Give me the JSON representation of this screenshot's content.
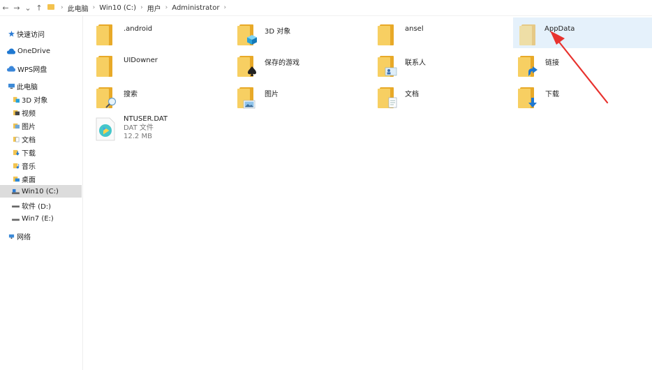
{
  "nav": {
    "back": "←",
    "forward": "→",
    "recent": "⌄",
    "up": "↑",
    "breadcrumb": [
      "此电脑",
      "Win10 (C:)",
      "用户",
      "Administrator"
    ]
  },
  "sidebar": {
    "items": [
      {
        "label": "快速访问",
        "icon": "star-icon"
      },
      {
        "label": "OneDrive",
        "icon": "cloud-icon"
      },
      {
        "label": "WPS网盘",
        "icon": "cloud-icon"
      },
      {
        "label": "此电脑",
        "icon": "computer-icon"
      },
      {
        "label": "3D 对象",
        "icon": "cube-icon"
      },
      {
        "label": "视频",
        "icon": "video-icon"
      },
      {
        "label": "图片",
        "icon": "picture-icon"
      },
      {
        "label": "文档",
        "icon": "document-icon"
      },
      {
        "label": "下载",
        "icon": "download-icon"
      },
      {
        "label": "音乐",
        "icon": "music-icon"
      },
      {
        "label": "桌面",
        "icon": "desktop-icon"
      },
      {
        "label": "Win10 (C:)",
        "icon": "drive-icon",
        "selected": true
      },
      {
        "label": "软件 (D:)",
        "icon": "drive-icon"
      },
      {
        "label": "Win7 (E:)",
        "icon": "drive-icon"
      },
      {
        "label": "网络",
        "icon": "network-icon"
      }
    ]
  },
  "content": {
    "folders": [
      {
        "name": ".android",
        "icon": "folder-icon"
      },
      {
        "name": "3D 对象",
        "icon": "folder-3d-icon"
      },
      {
        "name": "ansel",
        "icon": "folder-icon"
      },
      {
        "name": "AppData",
        "icon": "folder-icon",
        "hovered": true
      },
      {
        "name": "UIDowner",
        "icon": "folder-icon"
      },
      {
        "name": "保存的游戏",
        "icon": "folder-games-icon"
      },
      {
        "name": "联系人",
        "icon": "folder-contacts-icon"
      },
      {
        "name": "链接",
        "icon": "folder-links-icon"
      },
      {
        "name": "搜索",
        "icon": "folder-search-icon"
      },
      {
        "name": "图片",
        "icon": "folder-pictures-icon"
      },
      {
        "name": "文档",
        "icon": "folder-documents-icon"
      },
      {
        "name": "下载",
        "icon": "folder-downloads-icon"
      }
    ],
    "file": {
      "name": "NTUSER.DAT",
      "type": "DAT 文件",
      "size": "12.2 MB",
      "icon": "media-file-icon"
    }
  },
  "annotation": {
    "arrow_color": "#e8322e",
    "target": "AppData"
  },
  "colors": {
    "folder_light": "#f7cf62",
    "folder_dark": "#e8a928",
    "hover_bg": "#e5f1fb",
    "selected_bg": "#dcdcdc"
  }
}
